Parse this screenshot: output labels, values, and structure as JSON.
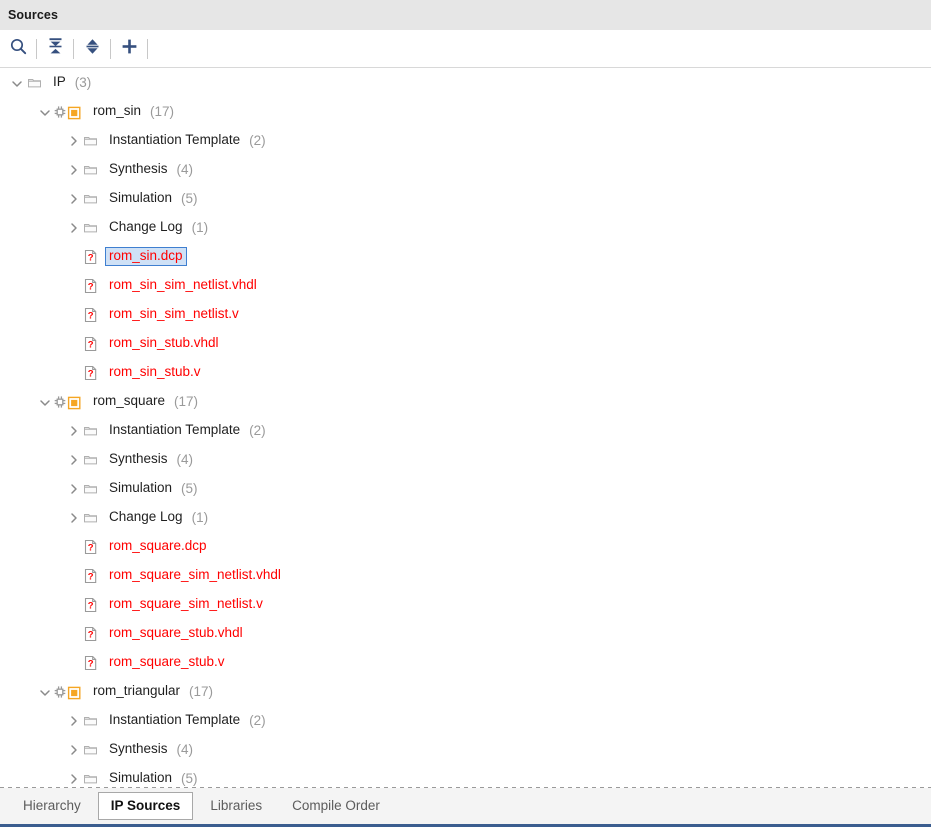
{
  "header": {
    "title": "Sources"
  },
  "toolbar": {
    "buttons": [
      {
        "name": "search-icon",
        "tooltip": "Search"
      },
      {
        "name": "collapse-all-icon",
        "tooltip": "Collapse All"
      },
      {
        "name": "expand-all-icon",
        "tooltip": "Expand All"
      },
      {
        "name": "add-sources-icon",
        "tooltip": "Add Sources"
      }
    ]
  },
  "tree": {
    "rows": [
      {
        "indent": 0,
        "twisty": "expanded",
        "icon": "folder-icon",
        "label": "IP",
        "count": "(3)",
        "red": false,
        "selected": false
      },
      {
        "indent": 1,
        "twisty": "expanded",
        "icon": "ip-core-icon",
        "label": "rom_sin",
        "count": "(17)",
        "red": false,
        "selected": false
      },
      {
        "indent": 2,
        "twisty": "collapsed",
        "icon": "folder-icon",
        "label": "Instantiation Template",
        "count": "(2)",
        "red": false,
        "selected": false
      },
      {
        "indent": 2,
        "twisty": "collapsed",
        "icon": "folder-icon",
        "label": "Synthesis",
        "count": "(4)",
        "red": false,
        "selected": false
      },
      {
        "indent": 2,
        "twisty": "collapsed",
        "icon": "folder-icon",
        "label": "Simulation",
        "count": "(5)",
        "red": false,
        "selected": false
      },
      {
        "indent": 2,
        "twisty": "collapsed",
        "icon": "folder-icon",
        "label": "Change Log",
        "count": "(1)",
        "red": false,
        "selected": false
      },
      {
        "indent": 2,
        "twisty": "none",
        "icon": "missing-file-icon",
        "label": "rom_sin.dcp",
        "count": "",
        "red": true,
        "selected": true
      },
      {
        "indent": 2,
        "twisty": "none",
        "icon": "missing-file-icon",
        "label": "rom_sin_sim_netlist.vhdl",
        "count": "",
        "red": true,
        "selected": false
      },
      {
        "indent": 2,
        "twisty": "none",
        "icon": "missing-file-icon",
        "label": "rom_sin_sim_netlist.v",
        "count": "",
        "red": true,
        "selected": false
      },
      {
        "indent": 2,
        "twisty": "none",
        "icon": "missing-file-icon",
        "label": "rom_sin_stub.vhdl",
        "count": "",
        "red": true,
        "selected": false
      },
      {
        "indent": 2,
        "twisty": "none",
        "icon": "missing-file-icon",
        "label": "rom_sin_stub.v",
        "count": "",
        "red": true,
        "selected": false
      },
      {
        "indent": 1,
        "twisty": "expanded",
        "icon": "ip-core-icon",
        "label": "rom_square",
        "count": "(17)",
        "red": false,
        "selected": false
      },
      {
        "indent": 2,
        "twisty": "collapsed",
        "icon": "folder-icon",
        "label": "Instantiation Template",
        "count": "(2)",
        "red": false,
        "selected": false
      },
      {
        "indent": 2,
        "twisty": "collapsed",
        "icon": "folder-icon",
        "label": "Synthesis",
        "count": "(4)",
        "red": false,
        "selected": false
      },
      {
        "indent": 2,
        "twisty": "collapsed",
        "icon": "folder-icon",
        "label": "Simulation",
        "count": "(5)",
        "red": false,
        "selected": false
      },
      {
        "indent": 2,
        "twisty": "collapsed",
        "icon": "folder-icon",
        "label": "Change Log",
        "count": "(1)",
        "red": false,
        "selected": false
      },
      {
        "indent": 2,
        "twisty": "none",
        "icon": "missing-file-icon",
        "label": "rom_square.dcp",
        "count": "",
        "red": true,
        "selected": false
      },
      {
        "indent": 2,
        "twisty": "none",
        "icon": "missing-file-icon",
        "label": "rom_square_sim_netlist.vhdl",
        "count": "",
        "red": true,
        "selected": false
      },
      {
        "indent": 2,
        "twisty": "none",
        "icon": "missing-file-icon",
        "label": "rom_square_sim_netlist.v",
        "count": "",
        "red": true,
        "selected": false
      },
      {
        "indent": 2,
        "twisty": "none",
        "icon": "missing-file-icon",
        "label": "rom_square_stub.vhdl",
        "count": "",
        "red": true,
        "selected": false
      },
      {
        "indent": 2,
        "twisty": "none",
        "icon": "missing-file-icon",
        "label": "rom_square_stub.v",
        "count": "",
        "red": true,
        "selected": false
      },
      {
        "indent": 1,
        "twisty": "expanded",
        "icon": "ip-core-icon",
        "label": "rom_triangular",
        "count": "(17)",
        "red": false,
        "selected": false
      },
      {
        "indent": 2,
        "twisty": "collapsed",
        "icon": "folder-icon",
        "label": "Instantiation Template",
        "count": "(2)",
        "red": false,
        "selected": false
      },
      {
        "indent": 2,
        "twisty": "collapsed",
        "icon": "folder-icon",
        "label": "Synthesis",
        "count": "(4)",
        "red": false,
        "selected": false
      },
      {
        "indent": 2,
        "twisty": "collapsed",
        "icon": "folder-icon",
        "label": "Simulation",
        "count": "(5)",
        "red": false,
        "selected": false
      }
    ]
  },
  "tabs": {
    "items": [
      {
        "label": "Hierarchy",
        "active": false
      },
      {
        "label": "IP Sources",
        "active": true
      },
      {
        "label": "Libraries",
        "active": false
      },
      {
        "label": "Compile Order",
        "active": false
      }
    ]
  },
  "colors": {
    "header_bg": "#e6e6e6",
    "icon_blue": "#36507f",
    "missing_file_red": "#ff0000",
    "ip_orange": "#f5a623",
    "selection_bg": "#cfe1f6",
    "selection_border": "#3f7fd0",
    "bottom_accent": "#3b5d8f"
  }
}
